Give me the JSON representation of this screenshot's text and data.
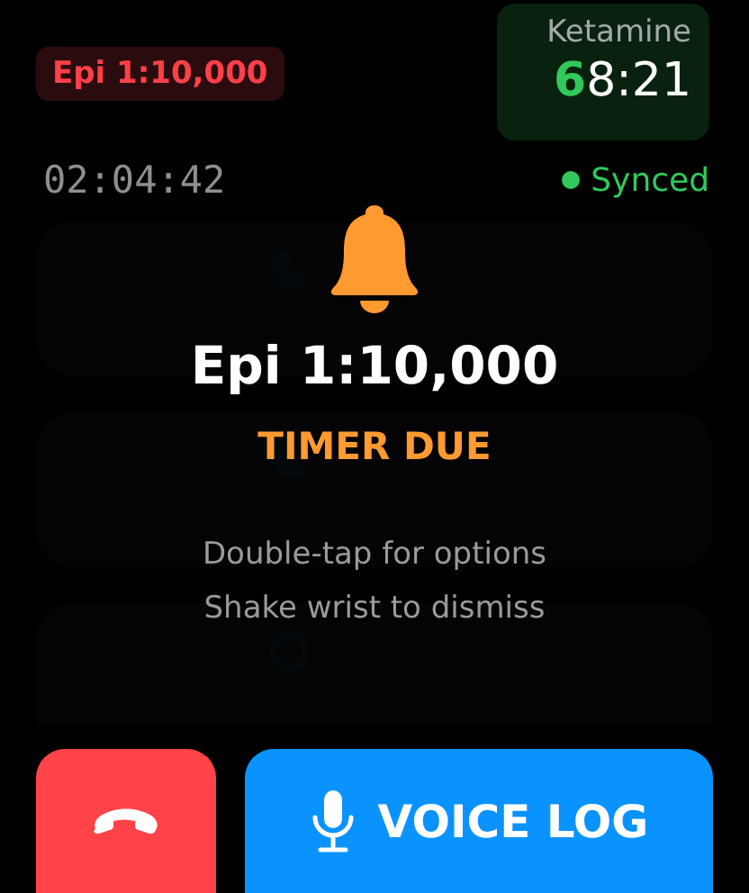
{
  "header": {
    "active_drug": "Epi 1:10,000",
    "timer_card": {
      "label": "Ketamine",
      "countdown": "6",
      "clock": "8:21"
    },
    "elapsed": "02:04:42",
    "sync": {
      "label": "Synced",
      "on": true
    }
  },
  "log": [
    {
      "kind": "pill"
    },
    {
      "kind": "pill"
    },
    {
      "kind": "event"
    }
  ],
  "alert": {
    "title": "Epi 1:10,000",
    "status": "TIMER DUE",
    "hints": [
      "Double-tap for options",
      "Shake wrist to dismiss"
    ]
  },
  "actions": {
    "end_call": true,
    "voice": "VOICE LOG"
  }
}
